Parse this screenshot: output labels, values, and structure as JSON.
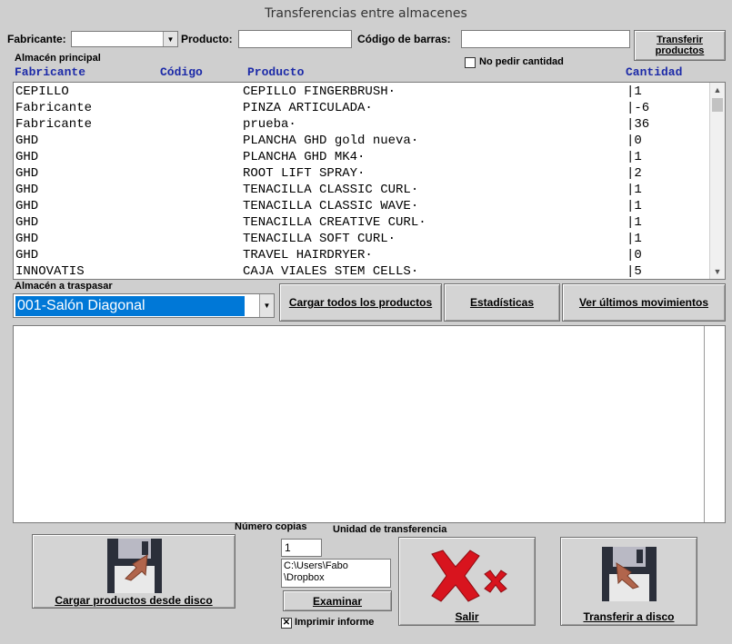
{
  "window": {
    "title": "Transferencias entre almacenes"
  },
  "filters": {
    "fabricante_label": "Fabricante:",
    "fabricante_value": "",
    "producto_label": "Producto:",
    "producto_value": "",
    "codigo_barras_label": "Código de barras:",
    "codigo_barras_value": "",
    "transfer_button": "Transferir productos"
  },
  "main_store": {
    "label": "Almacén principal",
    "no_pedir_label": "No pedir cantidad",
    "no_pedir_checked": false,
    "columns": [
      "Fabricante",
      "Código",
      "Producto",
      "Cantidad"
    ],
    "rows": [
      {
        "fabricante": "CEPILLO",
        "codigo": "",
        "producto": "CEPILLO FINGERBRUSH·",
        "cantidad": "|1"
      },
      {
        "fabricante": "Fabricante",
        "codigo": "",
        "producto": "PINZA ARTICULADA·",
        "cantidad": "|-6"
      },
      {
        "fabricante": "Fabricante",
        "codigo": "",
        "producto": "prueba·",
        "cantidad": "|36"
      },
      {
        "fabricante": "GHD",
        "codigo": "",
        "producto": "PLANCHA GHD gold nueva·",
        "cantidad": "|0"
      },
      {
        "fabricante": "GHD",
        "codigo": "",
        "producto": "PLANCHA GHD MK4·",
        "cantidad": "|1"
      },
      {
        "fabricante": "GHD",
        "codigo": "",
        "producto": "ROOT LIFT SPRAY·",
        "cantidad": "|2"
      },
      {
        "fabricante": "GHD",
        "codigo": "",
        "producto": "TENACILLA CLASSIC CURL·",
        "cantidad": "|1"
      },
      {
        "fabricante": "GHD",
        "codigo": "",
        "producto": "TENACILLA CLASSIC WAVE·",
        "cantidad": "|1"
      },
      {
        "fabricante": "GHD",
        "codigo": "",
        "producto": "TENACILLA CREATIVE CURL·",
        "cantidad": "|1"
      },
      {
        "fabricante": "GHD",
        "codigo": "",
        "producto": "TENACILLA SOFT CURL·",
        "cantidad": "|1"
      },
      {
        "fabricante": "GHD",
        "codigo": "",
        "producto": "TRAVEL HAIRDRYER·",
        "cantidad": "|0"
      },
      {
        "fabricante": "INNOVATIS",
        "codigo": "",
        "producto": "CAJA VIALES STEM CELLS·",
        "cantidad": "|5"
      }
    ]
  },
  "target_store": {
    "label": "Almacén a traspasar",
    "selected": "001-Salón Diagonal"
  },
  "actions": {
    "cargar_todos": "Cargar todos los productos",
    "estadisticas": "Estadísticas",
    "ver_movimientos": "Ver últimos movimientos"
  },
  "log": {
    "text": ""
  },
  "bottom": {
    "numero_copias_label": "Número copias",
    "numero_copias_value": "1",
    "unidad_label": "Unidad de transferencia",
    "unidad_value": "C:\\Users\\Fabo\n\\Dropbox",
    "examinar": "Examinar",
    "imprimir_label": "Imprimir informe",
    "imprimir_checked": true,
    "cargar_disco": "Cargar productos desde disco",
    "salir": "Salir",
    "transferir_disco": "Transferir a disco"
  },
  "icons": {
    "combo_arrow": "chevron-down-icon",
    "load_disk": "floppy-load-icon",
    "exit": "red-x-icon",
    "save_disk": "floppy-save-icon"
  },
  "colors": {
    "background": "#cfcfcf",
    "header_blue": "#1c2aa8",
    "selection_blue": "#0078d7",
    "exit_red": "#d8141e"
  }
}
